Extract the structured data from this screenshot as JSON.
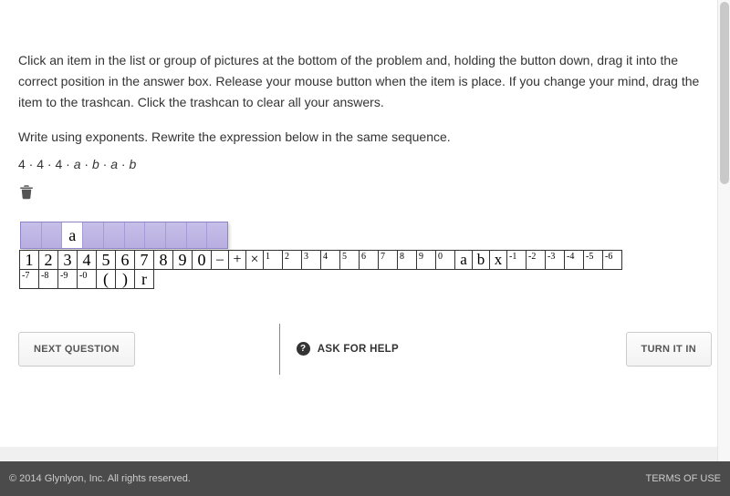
{
  "instructions": "Click an item in the list or group of pictures at the bottom of the problem and, holding the button down, drag it into the correct position in the answer box. Release your mouse button when the item is place. If you change your mind, drag the item to the trashcan. Click the trashcan to clear all your answers.",
  "prompt": "Write using exponents. Rewrite the expression below in the same sequence.",
  "expression_plain": "4 · 4 · 4 · a · b · a · b",
  "answer_slots": [
    "",
    "",
    "a",
    "",
    "",
    "",
    "",
    "",
    "",
    ""
  ],
  "tiles_row1_large": [
    "1",
    "2",
    "3",
    "4",
    "5",
    "6",
    "7",
    "8",
    "9",
    "0"
  ],
  "tiles_row1_ops": [
    "–",
    "+",
    "×"
  ],
  "tiles_row1_sup1": [
    "1",
    "2",
    "3",
    "4",
    "5",
    "6",
    "7",
    "8",
    "9",
    "0"
  ],
  "tiles_row1_vars": [
    "a",
    "b",
    "x"
  ],
  "tiles_row1_sup2": [
    "-1",
    "-2",
    "-3",
    "-4",
    "-5",
    "-6"
  ],
  "tiles_row2_sup": [
    "-7",
    "-8",
    "-9",
    "-0"
  ],
  "tiles_row2_sym": [
    "(",
    ")",
    "r"
  ],
  "buttons": {
    "next": "NEXT QUESTION",
    "help": "ASK FOR HELP",
    "turnin": "TURN IT IN"
  },
  "footer": {
    "copyright": "© 2014 Glynlyon, Inc. All rights reserved.",
    "terms": "TERMS OF USE"
  }
}
